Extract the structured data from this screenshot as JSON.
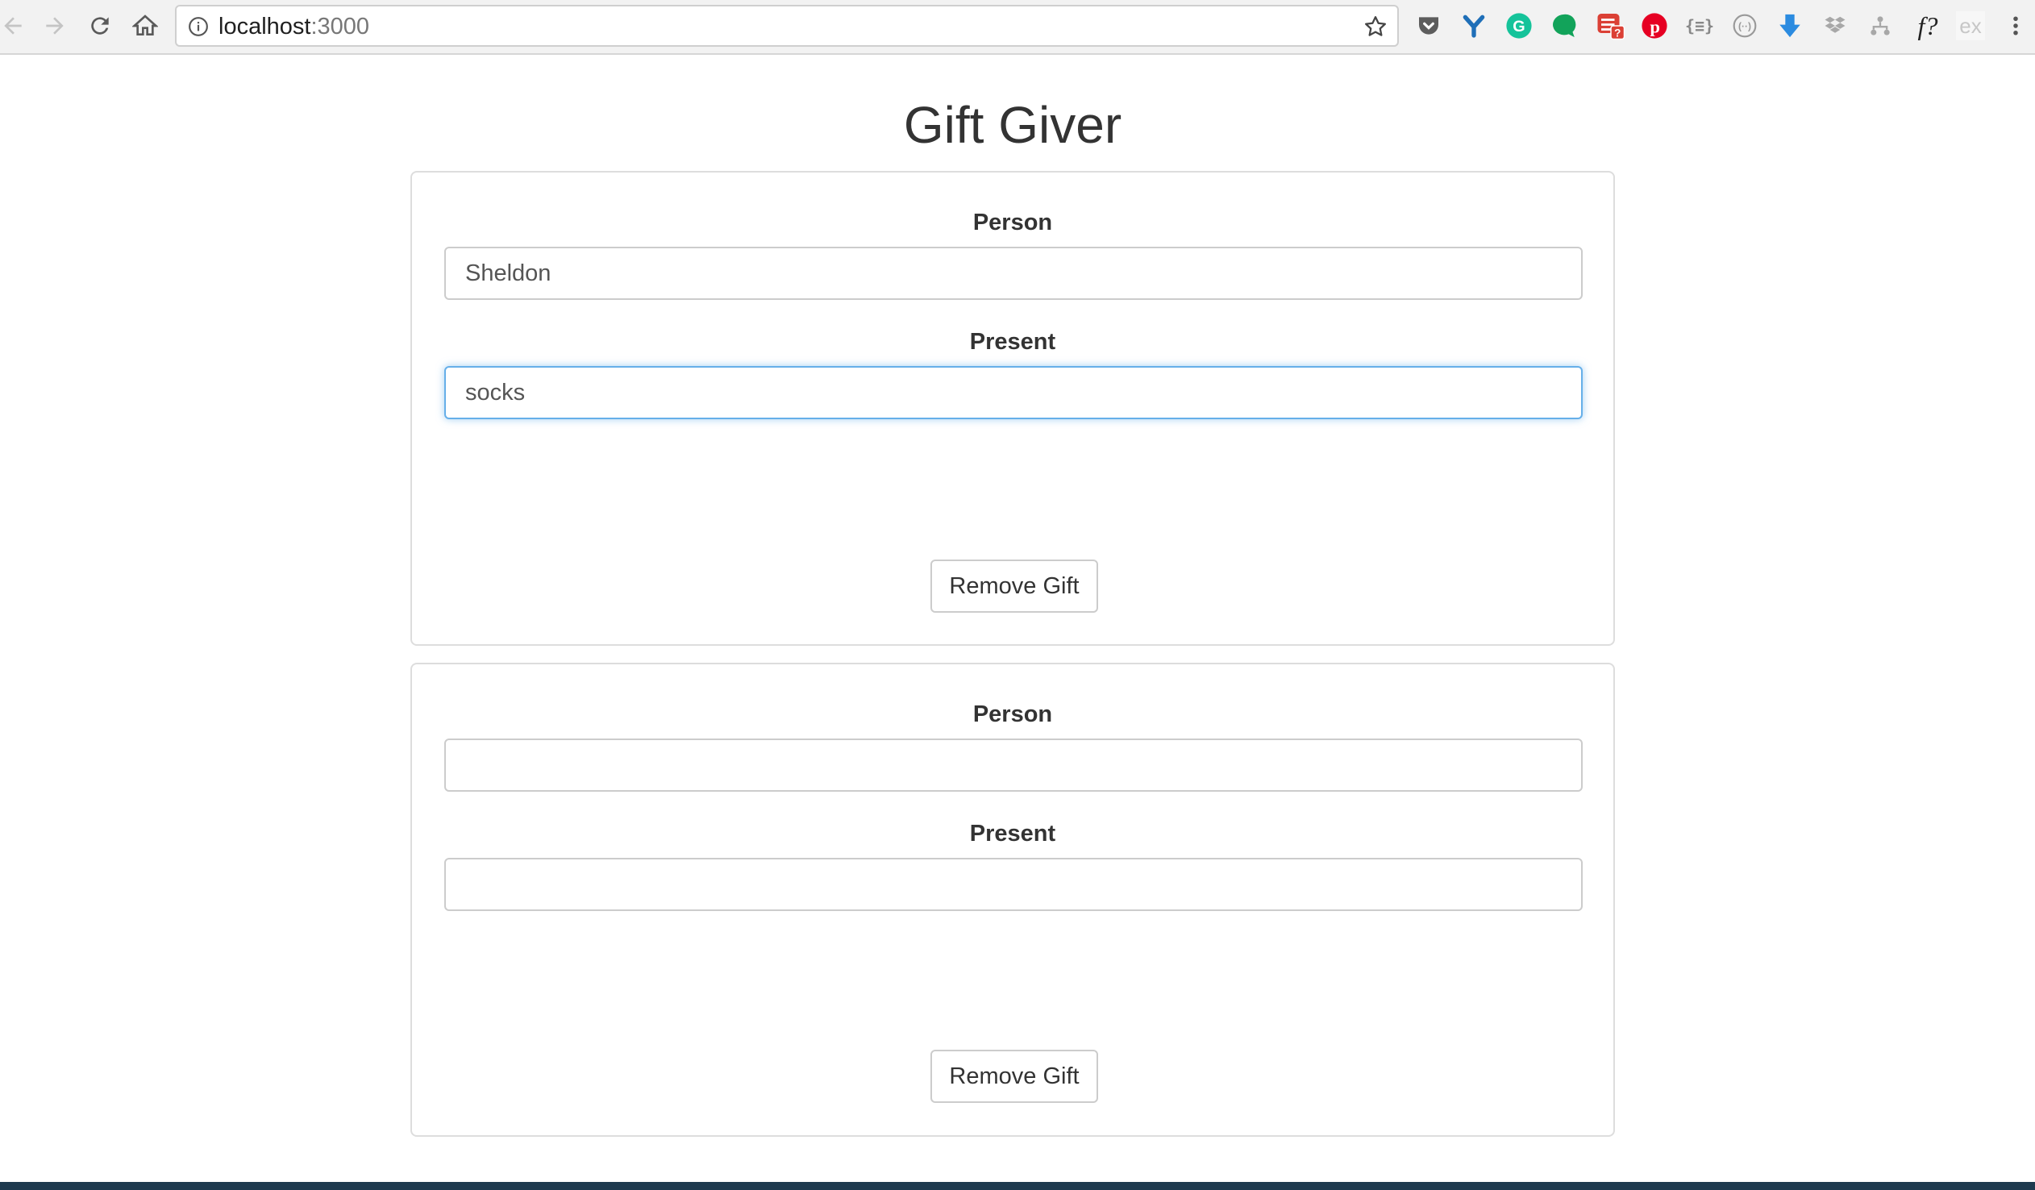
{
  "browser": {
    "url_host": "localhost",
    "url_port": ":3000"
  },
  "app": {
    "title": "Gift Giver"
  },
  "gifts": [
    {
      "person_label": "Person",
      "person_value": "Sheldon",
      "present_label": "Present",
      "present_value": "socks",
      "remove_label": "Remove Gift"
    },
    {
      "person_label": "Person",
      "person_value": "",
      "present_label": "Present",
      "present_value": "",
      "remove_label": "Remove Gift"
    }
  ],
  "extensions": [
    {
      "icon": "pocket-icon",
      "color": "#5d5d5d"
    },
    {
      "icon": "y-icon",
      "color": "#1f6fb8"
    },
    {
      "icon": "grammarly-icon",
      "color": "#15c39a"
    },
    {
      "icon": "speech-bubble-icon",
      "color": "#12a35a"
    },
    {
      "icon": "todoist-icon",
      "color": "#db4035",
      "badge": "?"
    },
    {
      "icon": "pinterest-icon",
      "color": "#e60023"
    },
    {
      "icon": "json-formatter-icon",
      "color": "#888888",
      "glyph": "{≡}"
    },
    {
      "icon": "circle-dots-icon",
      "color": "#888888"
    },
    {
      "icon": "download-arrow-icon",
      "color": "#2b8be0"
    },
    {
      "icon": "dropbox-icon",
      "color": "#a8a8a8"
    },
    {
      "icon": "tree-icon",
      "color": "#a8a8a8"
    },
    {
      "icon": "font-question-icon",
      "color": "#222222",
      "glyph": "f?"
    },
    {
      "icon": "ex-icon",
      "color": "#bdbdbd",
      "glyph": "ex"
    }
  ]
}
